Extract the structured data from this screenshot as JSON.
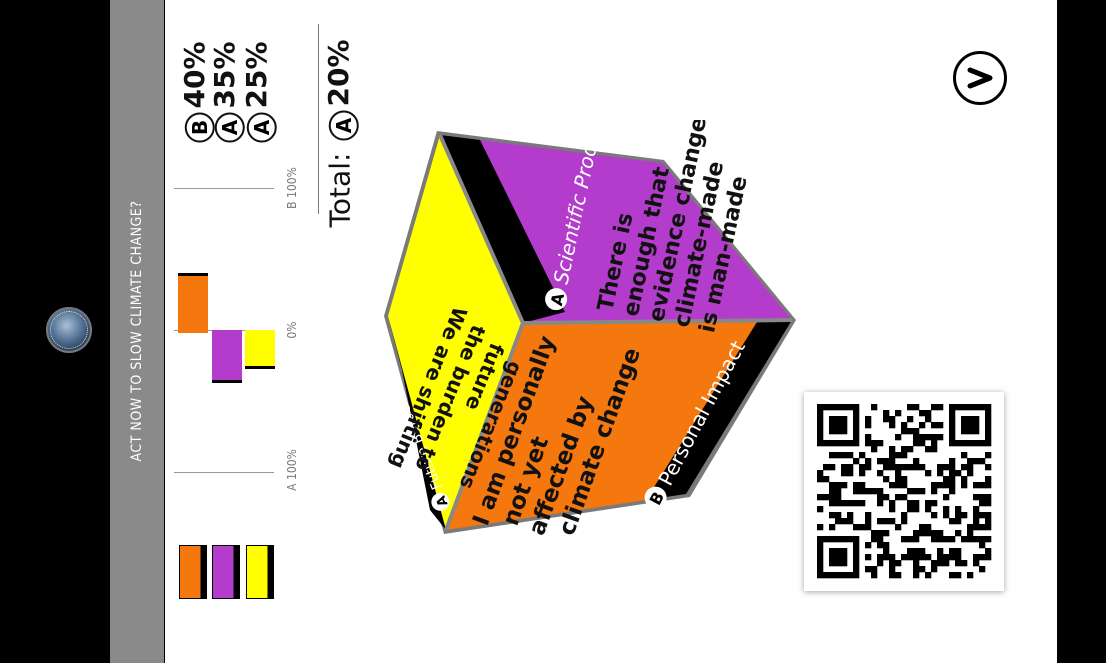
{
  "sidebar": {
    "title": "ACT NOW TO SLOW CLIMATE CHANGE?"
  },
  "results": {
    "rows": [
      {
        "letter": "B",
        "pct": "40%"
      },
      {
        "letter": "A",
        "pct": "35%"
      },
      {
        "letter": "A",
        "pct": "25%"
      }
    ],
    "total_label": "Total:",
    "total_letter": "A",
    "total_pct": "20%"
  },
  "chart_data": {
    "type": "bar",
    "orientation": "diverging",
    "axis_labels": {
      "left": "A 100%",
      "center": "0%",
      "right": "B 100%"
    },
    "series": [
      {
        "color": "#f5780f",
        "value": 40
      },
      {
        "color": "#b43ccc",
        "value": -35
      },
      {
        "color": "#ffff00",
        "value": -25
      }
    ],
    "range": [
      -100,
      100
    ]
  },
  "legend": {
    "colors": [
      "#f5780f",
      "#b43ccc",
      "#ffff00"
    ]
  },
  "cube": {
    "top": {
      "badge": "A",
      "header": "Scientific Proof",
      "statement": "There is enough that evidence change climate-made is man-made",
      "lines": [
        "There is",
        "enough that",
        "evidence change",
        "climate-made",
        "is man-made"
      ],
      "color": "#b43ccc"
    },
    "right": {
      "badge": "B",
      "header": "Personal Impact",
      "lines": [
        "I am personally",
        "not yet",
        "affected by",
        "climate change"
      ],
      "color": "#f5780f"
    },
    "left": {
      "badge": "A",
      "header": "Future Burden",
      "lines": [
        "We are shifting",
        "the burden to",
        "future",
        "generations"
      ],
      "color": "#ffff00"
    }
  },
  "nav": {
    "next_icon": "chevron-right-icon"
  },
  "qr": {
    "icon": "qr-code-icon"
  }
}
